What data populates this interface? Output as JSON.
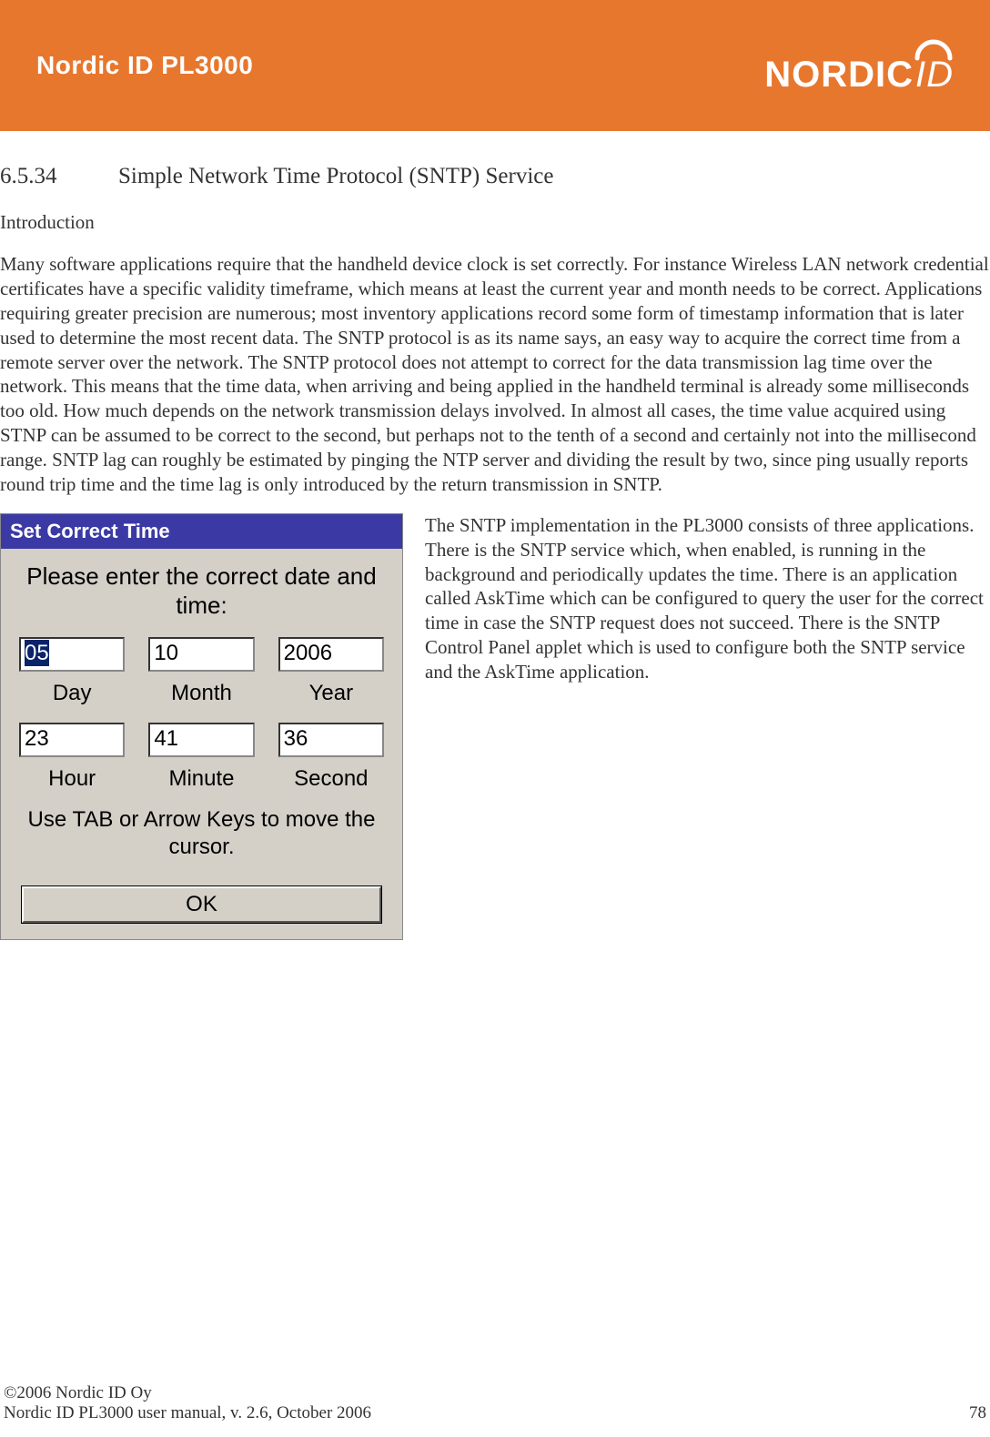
{
  "header": {
    "title": "Nordic ID PL3000",
    "brand_main": "NORDIC",
    "brand_suffix": "ID"
  },
  "section": {
    "number": "6.5.34",
    "title": "Simple Network Time Protocol (SNTP) Service"
  },
  "subheading": "Introduction",
  "para1": "Many software applications require that the handheld device clock is set correctly. For instance Wireless LAN network credential certificates have a specific validity timeframe, which means at least the current year and month needs to be correct. Applications requiring greater precision are numerous; most inventory applications record some form of timestamp information that is later used to determine the most recent data. The SNTP protocol is as its name says, an easy way to acquire the correct time from a remote server over the network. The SNTP protocol does not attempt to correct for the data transmission lag time over the network. This means that the time data, when arriving and being applied in the handheld terminal is already some milliseconds too old. How much depends on the network transmission delays involved. In almost all cases, the time value acquired using STNP can be assumed to be correct to the second, but perhaps not to the tenth of a second and certainly not into the millisecond range. SNTP lag can roughly be estimated by pinging the NTP server and dividing the result by two, since ping usually reports round trip time and the time lag is only introduced by the return transmission in SNTP.",
  "para2": "The SNTP implementation in the PL3000 consists of three applications. There is the SNTP service which, when enabled, is running in the background and periodically updates the time. There is an application called AskTime which can be configured to query the user for the correct time in case the SNTP request does not succeed. There is the SNTP Control Panel applet which is used to configure both the SNTP service and the AskTime application.",
  "dialog": {
    "title": "Set Correct Time",
    "prompt": "Please enter the correct date and time:",
    "fields": {
      "day": {
        "value": "05",
        "label": "Day"
      },
      "month": {
        "value": "10",
        "label": "Month"
      },
      "year": {
        "value": "2006",
        "label": "Year"
      },
      "hour": {
        "value": "23",
        "label": "Hour"
      },
      "minute": {
        "value": "41",
        "label": "Minute"
      },
      "second": {
        "value": "36",
        "label": "Second"
      }
    },
    "hint": "Use TAB or Arrow Keys to move the cursor.",
    "ok_label": "OK"
  },
  "footer": {
    "copyright": "©2006 Nordic ID Oy",
    "manual_line": "Nordic ID PL3000 user manual, v. 2.6, October 2006",
    "page_number": "78"
  }
}
